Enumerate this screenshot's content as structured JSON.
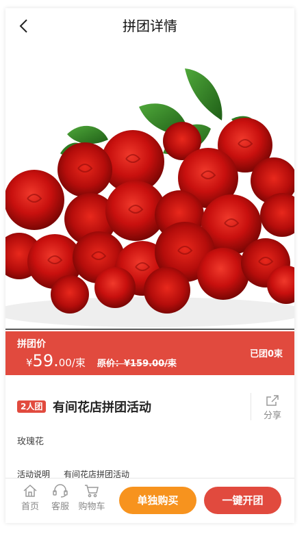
{
  "header": {
    "title": "拼团详情",
    "back_icon": "chevron-left-icon"
  },
  "hero": {
    "image": "red-roses-bouquet"
  },
  "price_bar": {
    "label": "拼团价",
    "currency": "¥",
    "price_int": "59.",
    "price_dec": "00",
    "unit": "/束",
    "original_price": "原价：¥159.00/束",
    "sold": "已团0束",
    "color": "#e14a3e"
  },
  "activity": {
    "badge": "2人团",
    "title": "有间花店拼团活动",
    "share_label": "分享",
    "share_icon": "share-icon",
    "subtitle": "玫瑰花",
    "desc_label": "活动说明",
    "desc_value": "有间花店拼团活动"
  },
  "bottom_nav": {
    "home": "首页",
    "service": "客服",
    "cart": "购物车",
    "buy_single": "单独购买",
    "start_group": "一键开团",
    "colors": {
      "single": "#f7931e",
      "group": "#e14a3e"
    }
  }
}
